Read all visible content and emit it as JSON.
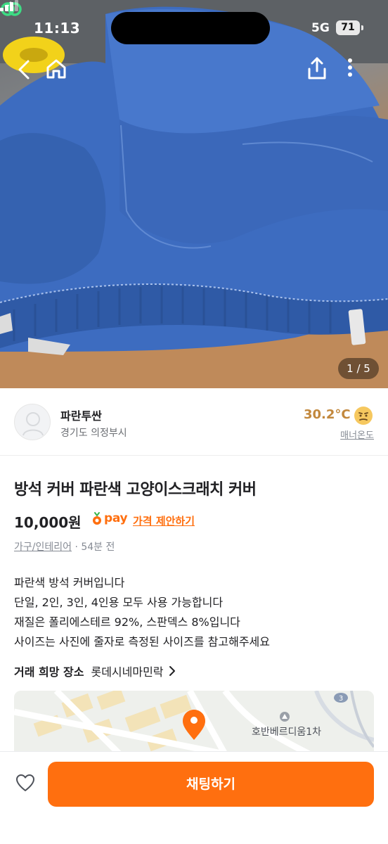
{
  "status_bar": {
    "time": "11:13",
    "network": "5G",
    "battery": "71"
  },
  "photo": {
    "counter": "1 / 5"
  },
  "seller": {
    "name": "파란투싼",
    "region": "경기도 의정부시",
    "temperature": "30.2°C",
    "manner_label": "매너온도"
  },
  "product": {
    "title": "방석 커버 파란색 고양이스크래치 커버",
    "price": "10,000원",
    "pay_label": "pay",
    "offer_label": "가격 제안하기",
    "category": "가구/인테리어",
    "time_ago": "54분 전",
    "description": [
      "파란색 방석 커버입니다",
      "단일, 2인, 3인, 4인용 모두 사용 가능합니다",
      "재질은 폴리에스테르 92%, 스판덱스 8%입니다",
      "사이즈는 사진에 줄자로 측정된 사이즈를 참고해주세요"
    ]
  },
  "meeting": {
    "label": "거래 희망 장소",
    "place": "롯데시네마민락"
  },
  "map": {
    "poi_label": "호반베르디움1차",
    "road_badge": "3"
  },
  "bottom_bar": {
    "chat_label": "채팅하기"
  },
  "colors": {
    "brand_orange": "#ff6f0f",
    "manner_temp": "#c2883d",
    "text_primary": "#212124",
    "text_secondary": "#868b94"
  },
  "icons": [
    "location-arrow-icon",
    "link-icon",
    "signal-icon",
    "battery-icon",
    "back-icon",
    "home-icon",
    "share-icon",
    "more-icon",
    "avatar-placeholder-icon",
    "manner-face-icon",
    "carrot-pay-icon",
    "chevron-right-icon",
    "map-pin-icon",
    "heart-icon"
  ]
}
